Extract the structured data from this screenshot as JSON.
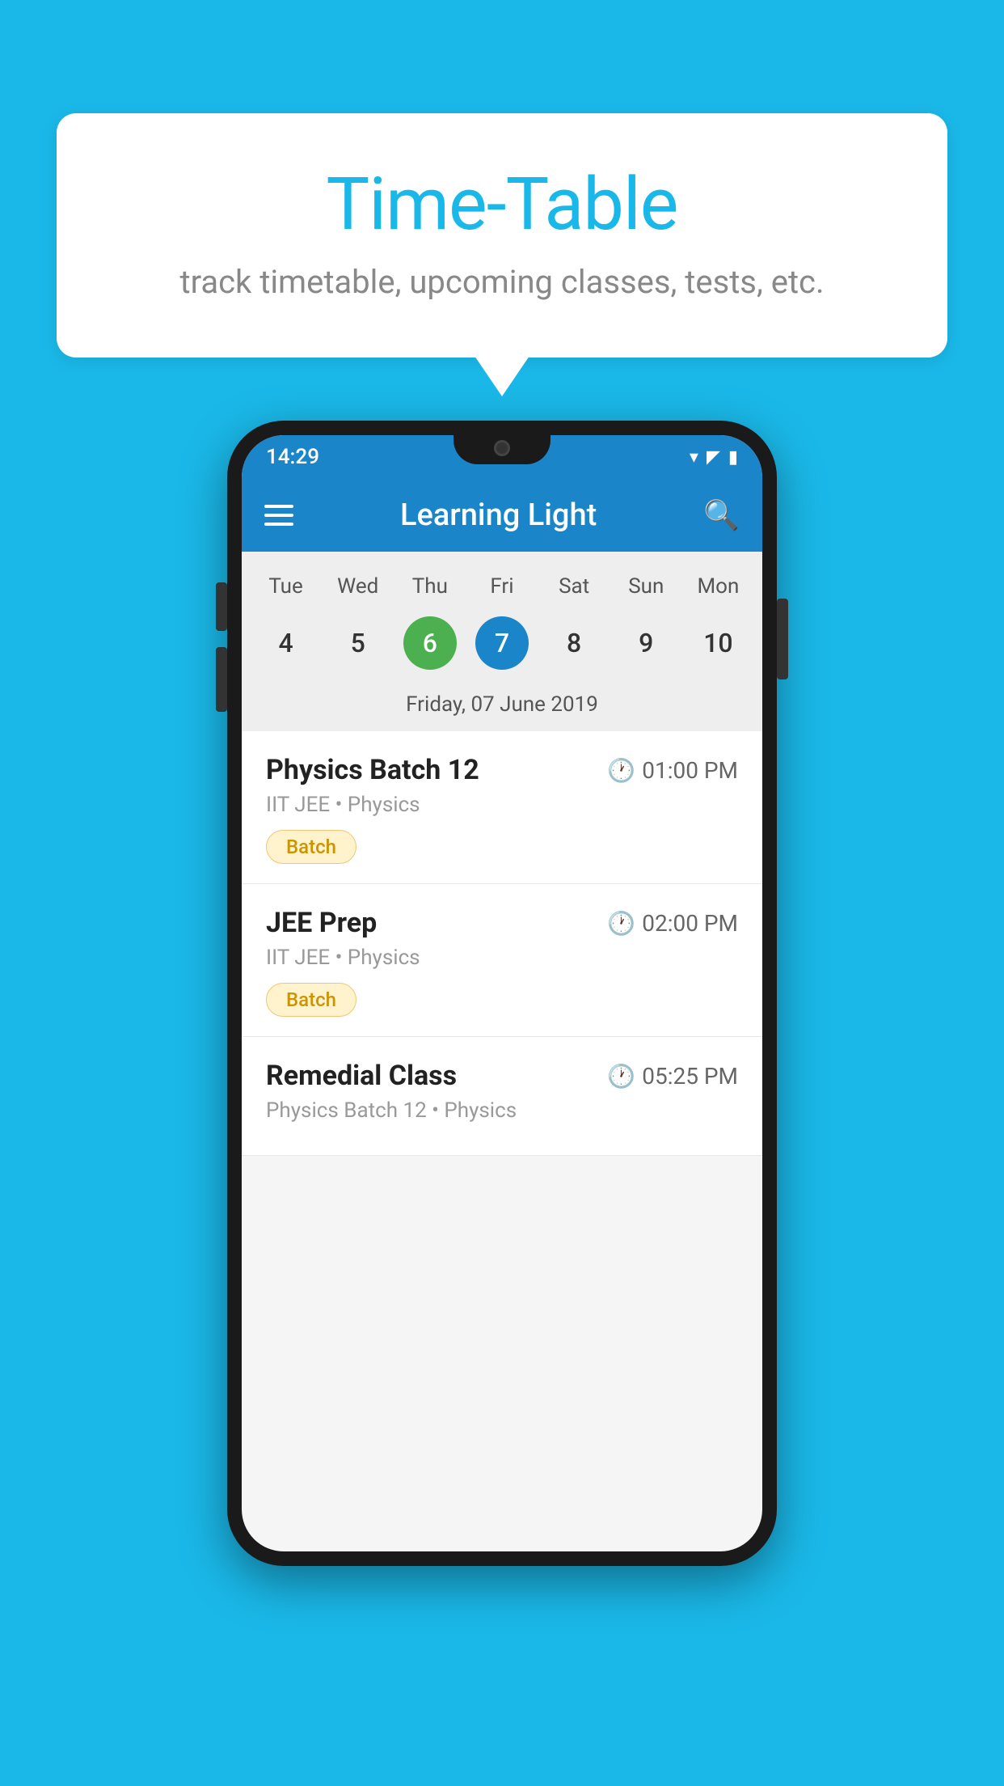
{
  "background": {
    "color": "#1ab8e8"
  },
  "speech_bubble": {
    "title": "Time-Table",
    "subtitle": "track timetable, upcoming classes, tests, etc."
  },
  "app": {
    "name": "Learning Light"
  },
  "status_bar": {
    "time": "14:29"
  },
  "calendar": {
    "selected_date_label": "Friday, 07 June 2019",
    "days": [
      "Tue",
      "Wed",
      "Thu",
      "Fri",
      "Sat",
      "Sun",
      "Mon"
    ],
    "dates": [
      {
        "num": "4",
        "state": "normal"
      },
      {
        "num": "5",
        "state": "normal"
      },
      {
        "num": "6",
        "state": "today"
      },
      {
        "num": "7",
        "state": "selected"
      },
      {
        "num": "8",
        "state": "normal"
      },
      {
        "num": "9",
        "state": "normal"
      },
      {
        "num": "10",
        "state": "normal"
      }
    ]
  },
  "schedule": {
    "items": [
      {
        "title": "Physics Batch 12",
        "time": "01:00 PM",
        "subtitle": "IIT JEE • Physics",
        "badge": "Batch"
      },
      {
        "title": "JEE Prep",
        "time": "02:00 PM",
        "subtitle": "IIT JEE • Physics",
        "badge": "Batch"
      },
      {
        "title": "Remedial Class",
        "time": "05:25 PM",
        "subtitle": "Physics Batch 12 • Physics",
        "badge": ""
      }
    ]
  },
  "labels": {
    "menu_icon": "≡",
    "search_icon": "🔍",
    "clock_icon": "🕐"
  }
}
